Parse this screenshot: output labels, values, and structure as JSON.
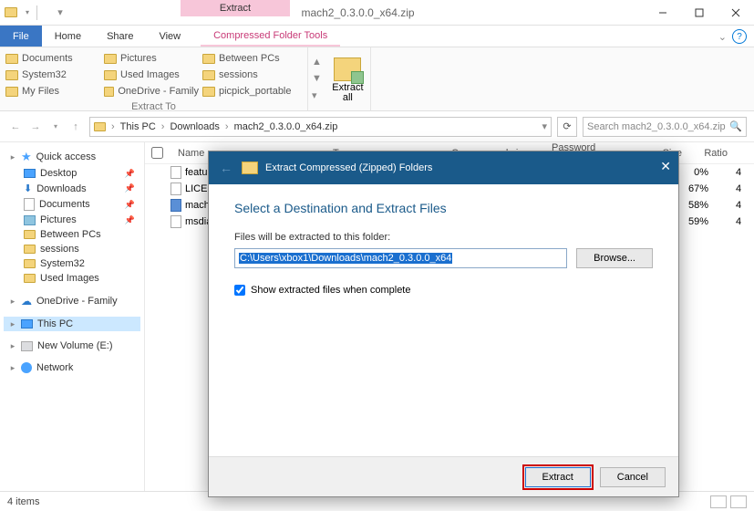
{
  "window": {
    "title": "mach2_0.3.0.0_x64.zip"
  },
  "ribbon": {
    "context_tab_group": "Extract",
    "tabs": {
      "file": "File",
      "home": "Home",
      "share": "Share",
      "view": "View",
      "tools": "Compressed Folder Tools"
    },
    "extract_to": {
      "items": [
        "Documents",
        "Pictures",
        "Between PCs",
        "System32",
        "Used Images",
        "sessions",
        "My Files",
        "OneDrive - Family",
        "picpick_portable"
      ],
      "label": "Extract To"
    },
    "extract_all": "Extract\nall"
  },
  "addr": {
    "crumbs": [
      "This PC",
      "Downloads",
      "mach2_0.3.0.0_x64.zip"
    ]
  },
  "search_placeholder": "Search mach2_0.3.0.0_x64.zip",
  "sidebar": {
    "quick": "Quick access",
    "quick_items": [
      "Desktop",
      "Downloads",
      "Documents",
      "Pictures",
      "Between PCs",
      "sessions",
      "System32",
      "Used Images"
    ],
    "onedrive": "OneDrive - Family",
    "thispc": "This PC",
    "volume": "New Volume (E:)",
    "network": "Network"
  },
  "columns": {
    "name": "Name",
    "type": "Type",
    "compressed": "Compressed size",
    "password": "Password ...",
    "size": "Size",
    "ratio": "Ratio"
  },
  "files": [
    {
      "name": "features.txt",
      "ratio": "0%",
      "last": "4"
    },
    {
      "name": "LICENSE",
      "ratio": "67%",
      "last": "4"
    },
    {
      "name": "mach2.exe",
      "ratio": "58%",
      "last": "4"
    },
    {
      "name": "msdia140.dll",
      "ratio": "59%",
      "last": "4"
    }
  ],
  "status": {
    "items": "4 items"
  },
  "dialog": {
    "title": "Extract Compressed (Zipped) Folders",
    "heading": "Select a Destination and Extract Files",
    "label": "Files will be extracted to this folder:",
    "path": "C:\\Users\\xbox1\\Downloads\\mach2_0.3.0.0_x64",
    "browse": "Browse...",
    "show_extracted": "Show extracted files when complete",
    "extract": "Extract",
    "cancel": "Cancel"
  }
}
